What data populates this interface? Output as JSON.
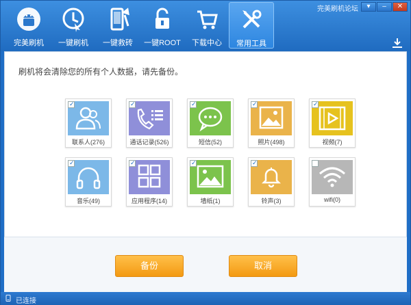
{
  "header": {
    "forum_link": "完美刷机论坛",
    "nav": [
      {
        "label": "完美刷机",
        "icon": "android-icon"
      },
      {
        "label": "一键刷机",
        "icon": "one-click-flash-icon"
      },
      {
        "label": "一键救砖",
        "icon": "phone-repair-icon"
      },
      {
        "label": "一键ROOT",
        "icon": "unlock-icon"
      },
      {
        "label": "下载中心",
        "icon": "cart-icon"
      },
      {
        "label": "常用工具",
        "icon": "tools-icon",
        "active": true
      }
    ],
    "window_buttons": [
      "▾",
      "–",
      "✕"
    ]
  },
  "main": {
    "notice": "刷机将会清除您的所有个人数据，请先备份。",
    "items": [
      {
        "label": "联系人(276)",
        "color": "#7cb8e8",
        "icon": "contacts-icon",
        "checked": true
      },
      {
        "label": "通话记录(526)",
        "color": "#8f8fd9",
        "icon": "call-log-icon",
        "checked": true
      },
      {
        "label": "短信(52)",
        "color": "#7cc34c",
        "icon": "sms-icon",
        "checked": true
      },
      {
        "label": "照片(498)",
        "color": "#eab34a",
        "icon": "photo-icon",
        "checked": true
      },
      {
        "label": "视频(7)",
        "color": "#e6c21e",
        "icon": "video-icon",
        "checked": true
      },
      {
        "label": "音乐(49)",
        "color": "#7cb8e8",
        "icon": "headphones-icon",
        "checked": true
      },
      {
        "label": "应用程序(14)",
        "color": "#8f8fd9",
        "icon": "apps-icon",
        "checked": true
      },
      {
        "label": "墙纸(1)",
        "color": "#7cc34c",
        "icon": "wallpaper-icon",
        "checked": true
      },
      {
        "label": "铃声(3)",
        "color": "#eab34a",
        "icon": "bell-icon",
        "checked": true
      },
      {
        "label": "wifi(0)",
        "color": "#b7b7b7",
        "icon": "wifi-icon",
        "checked": false
      }
    ]
  },
  "actions": {
    "backup": "备份",
    "cancel": "取消"
  },
  "status": {
    "text": "已连接"
  }
}
